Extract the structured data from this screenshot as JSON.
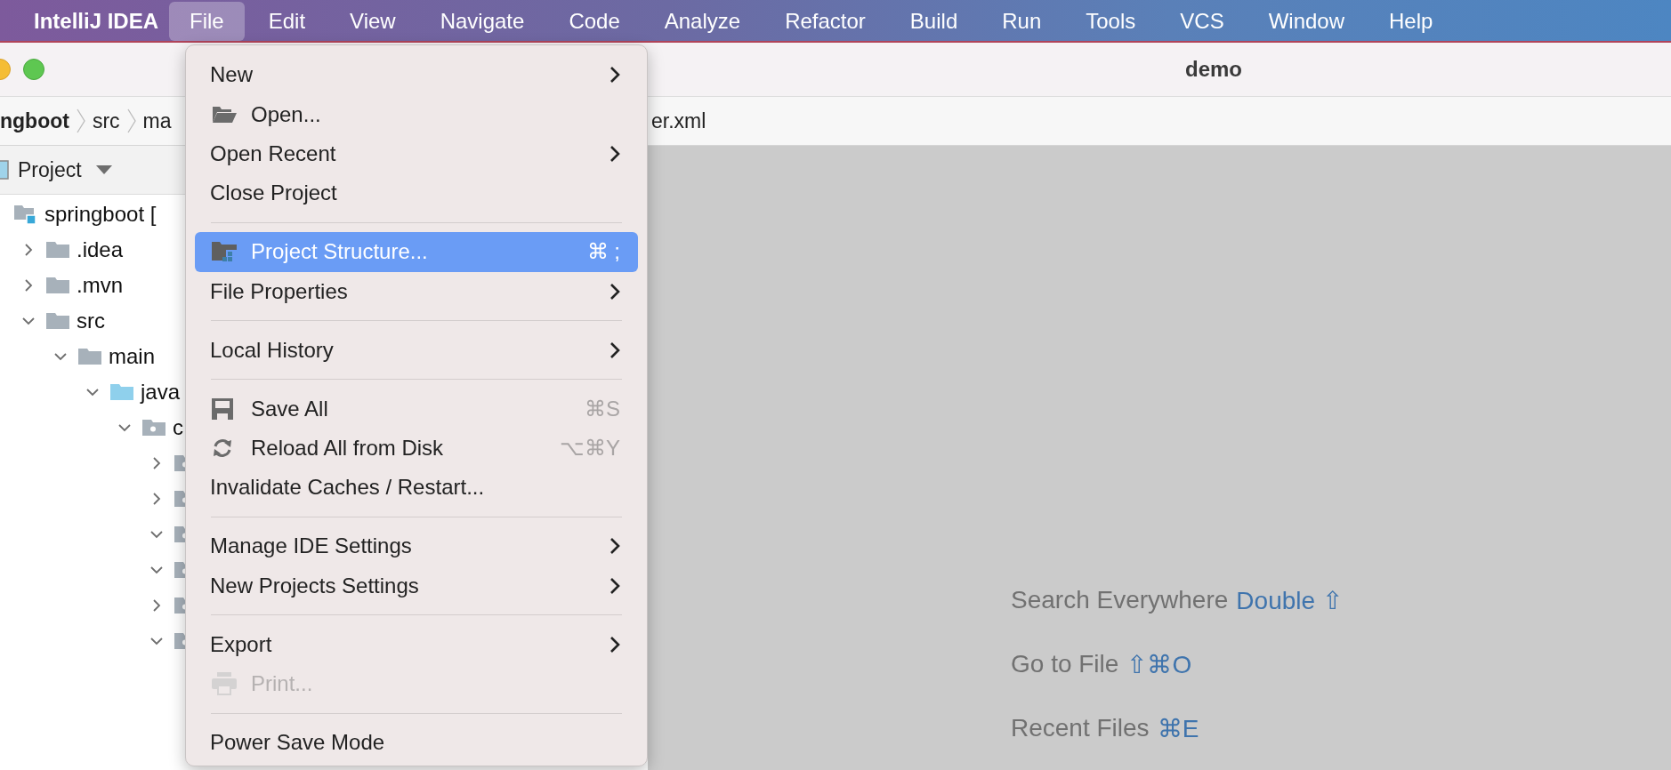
{
  "menubar": {
    "app": "IntelliJ IDEA",
    "items": [
      {
        "label": "File",
        "selected": true
      },
      {
        "label": "Edit",
        "selected": false
      },
      {
        "label": "View",
        "selected": false
      },
      {
        "label": "Navigate",
        "selected": false
      },
      {
        "label": "Code",
        "selected": false
      },
      {
        "label": "Analyze",
        "selected": false
      },
      {
        "label": "Refactor",
        "selected": false
      },
      {
        "label": "Build",
        "selected": false
      },
      {
        "label": "Run",
        "selected": false
      },
      {
        "label": "Tools",
        "selected": false
      },
      {
        "label": "VCS",
        "selected": false
      },
      {
        "label": "Window",
        "selected": false
      },
      {
        "label": "Help",
        "selected": false
      }
    ]
  },
  "window": {
    "title": "demo"
  },
  "breadcrumbs": {
    "left": [
      {
        "label": "ngboot",
        "bold": true
      },
      {
        "label": "src",
        "bold": false
      },
      {
        "label": "ma",
        "bold": false
      }
    ],
    "right": "er.xml"
  },
  "project_panel": {
    "title": "Project",
    "tree": [
      {
        "label": "springboot [",
        "kind": "module",
        "children": [
          {
            "label": ".idea",
            "kind": "folder",
            "expanded": false
          },
          {
            "label": ".mvn",
            "kind": "folder",
            "expanded": false
          },
          {
            "label": "src",
            "kind": "folder",
            "expanded": true,
            "children": [
              {
                "label": "main",
                "kind": "folder",
                "expanded": true,
                "children": [
                  {
                    "label": "java",
                    "kind": "source",
                    "expanded": true,
                    "children": [
                      {
                        "label": "c",
                        "kind": "package",
                        "expanded": true,
                        "children": [
                          {
                            "kind": "package",
                            "expanded": false
                          },
                          {
                            "kind": "package",
                            "expanded": false
                          },
                          {
                            "kind": "package",
                            "expanded": true
                          },
                          {
                            "kind": "package",
                            "expanded": true
                          },
                          {
                            "kind": "package",
                            "expanded": false
                          },
                          {
                            "kind": "package",
                            "expanded": true
                          }
                        ]
                      }
                    ]
                  }
                ]
              }
            ]
          }
        ]
      }
    ]
  },
  "file_menu": {
    "items": [
      {
        "kind": "item",
        "label": "New",
        "submenu": true,
        "selected": false,
        "disabled": false
      },
      {
        "kind": "open",
        "label": "Open...",
        "selected": false,
        "disabled": false
      },
      {
        "kind": "item",
        "label": "Open Recent",
        "submenu": true,
        "selected": false,
        "disabled": false
      },
      {
        "kind": "item",
        "label": "Close Project",
        "selected": false,
        "disabled": false
      },
      {
        "kind": "separator"
      },
      {
        "kind": "structure",
        "label": "Project Structure...",
        "shortcut": "⌘ ;",
        "selected": true,
        "disabled": false
      },
      {
        "kind": "item",
        "label": "File Properties",
        "submenu": true,
        "selected": false,
        "disabled": false
      },
      {
        "kind": "separator"
      },
      {
        "kind": "item",
        "label": "Local History",
        "submenu": true,
        "selected": false,
        "disabled": false
      },
      {
        "kind": "separator"
      },
      {
        "kind": "save",
        "label": "Save All",
        "shortcut": "⌘S",
        "selected": false,
        "disabled": false
      },
      {
        "kind": "reload",
        "label": "Reload All from Disk",
        "shortcut": "⌥⌘Y",
        "selected": false,
        "disabled": false
      },
      {
        "kind": "item",
        "label": "Invalidate Caches / Restart...",
        "selected": false,
        "disabled": false
      },
      {
        "kind": "separator"
      },
      {
        "kind": "item",
        "label": "Manage IDE Settings",
        "submenu": true,
        "selected": false,
        "disabled": false
      },
      {
        "kind": "item",
        "label": "New Projects Settings",
        "submenu": true,
        "selected": false,
        "disabled": false
      },
      {
        "kind": "separator"
      },
      {
        "kind": "item",
        "label": "Export",
        "submenu": true,
        "selected": false,
        "disabled": false
      },
      {
        "kind": "print",
        "label": "Print...",
        "selected": false,
        "disabled": true
      },
      {
        "kind": "separator"
      },
      {
        "kind": "item",
        "label": "Power Save Mode",
        "selected": false,
        "disabled": false
      }
    ]
  },
  "editor_hints": [
    {
      "label": "Search Everywhere",
      "shortcut": "Double ⇧"
    },
    {
      "label": "Go to File",
      "shortcut": "⇧⌘O"
    },
    {
      "label": "Recent Files",
      "shortcut": "⌘E"
    }
  ]
}
